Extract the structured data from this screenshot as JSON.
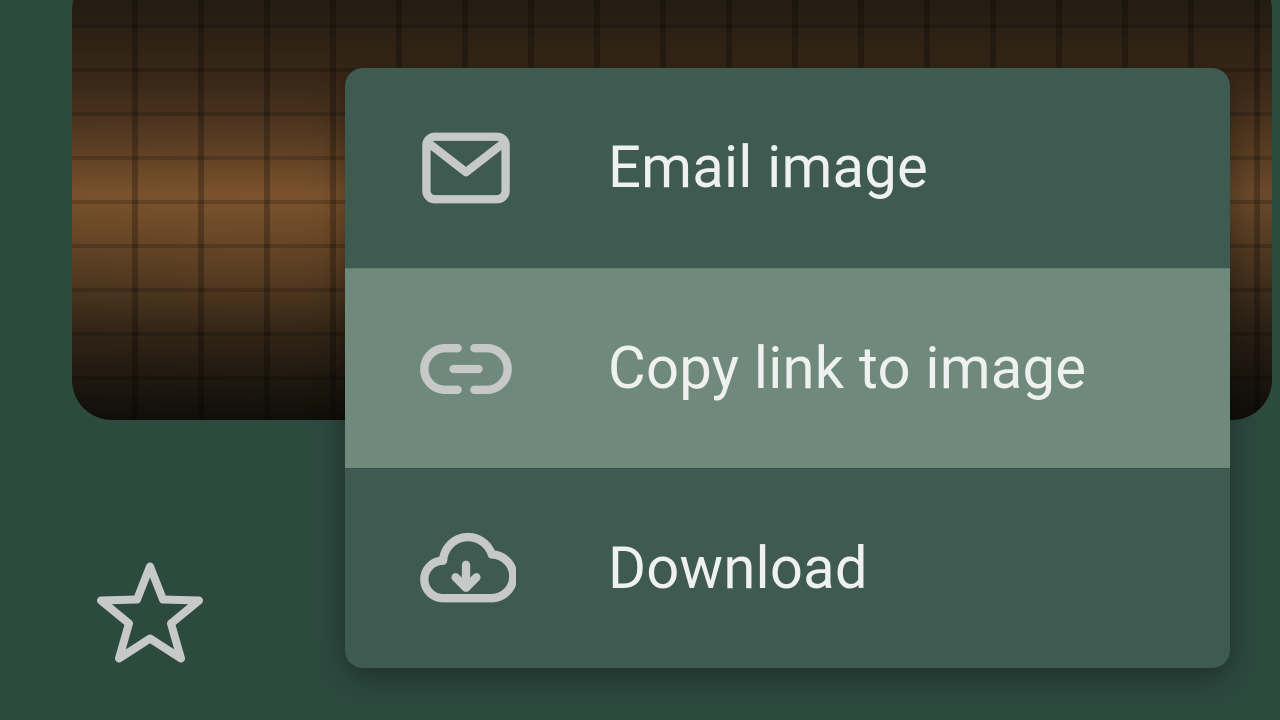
{
  "menu": {
    "items": [
      {
        "icon": "mail-icon",
        "label": "Email image"
      },
      {
        "icon": "link-icon",
        "label": "Copy link to image"
      },
      {
        "icon": "cloud-download-icon",
        "label": "Download"
      }
    ],
    "highlighted_index": 1
  }
}
